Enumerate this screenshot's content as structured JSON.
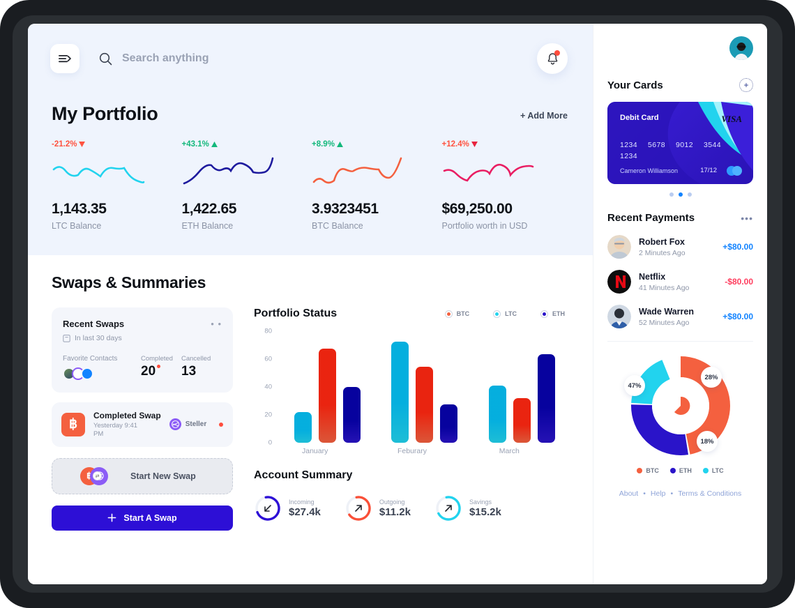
{
  "header": {
    "menu_icon": "hamburger-arrow-icon",
    "search_placeholder": "Search anything",
    "search_value": "",
    "search_icon": "search-icon",
    "bell_icon": "bell-icon"
  },
  "portfolio": {
    "title": "My Portfolio",
    "add_more": "+ Add More",
    "cards": [
      {
        "change": "-21.2%",
        "direction": "down",
        "value": "1,143.35",
        "label": "LTC Balance",
        "color": "#22d3ee"
      },
      {
        "change": "+43.1%",
        "direction": "up",
        "value": "1,422.65",
        "label": "ETH Balance",
        "color": "#1e1b9e"
      },
      {
        "change": "+8.9%",
        "direction": "up",
        "value": "3.9323451",
        "label": "BTC Balance",
        "color": "#f4603f"
      },
      {
        "change": "+12.4%",
        "direction": "down",
        "value": "$69,250.00",
        "label": "Portfolio worth in USD",
        "color": "#e91e63"
      }
    ]
  },
  "swaps": {
    "title": "Swaps & Summaries",
    "recent": {
      "title": "Recent Swaps",
      "subtitle": "In last 30 days",
      "calendar_icon": "calendar-icon",
      "menu_icon": "more-dots-icon",
      "favorite_label": "Favorite Contacts",
      "completed_label": "Completed",
      "completed_value": "20",
      "cancelled_label": "Cancelled",
      "cancelled_value": "13"
    },
    "completed_swap": {
      "coin_icon": "bitcoin-icon",
      "title": "Completed Swap",
      "time": "Yesterday 9:41 PM",
      "network": "Steller",
      "network_icon": "stellar-icon"
    },
    "new_swap": {
      "label": "Start New Swap"
    },
    "start_button": {
      "label": "Start A Swap",
      "plus_icon": "plus-icon"
    }
  },
  "chart_data": {
    "type": "bar",
    "title": "Portfolio Status",
    "categories": [
      "January",
      "Feburary",
      "March"
    ],
    "series": [
      {
        "name": "LTC",
        "color": "#22d3ee",
        "values": [
          24,
          80,
          45
        ]
      },
      {
        "name": "BTC",
        "color": "#f4603f",
        "values": [
          74,
          60,
          35
        ]
      },
      {
        "name": "ETH",
        "color": "#2a14c9",
        "values": [
          44,
          30,
          70
        ]
      }
    ],
    "legend": [
      "BTC",
      "LTC",
      "ETH"
    ],
    "legend_colors": {
      "BTC": "#f4603f",
      "LTC": "#22d3ee",
      "ETH": "#2a14c9"
    },
    "legend_position": "top-right",
    "yticks": [
      "80",
      "60",
      "40",
      "20",
      "0"
    ],
    "ylim": [
      0,
      88
    ],
    "xlabel": "",
    "ylabel": "",
    "grid": false
  },
  "account_summary": {
    "title": "Account Summary",
    "items": [
      {
        "label": "Incoming",
        "value": "$27.4k",
        "color": "#2d0fd6",
        "arrow": "arrow-down-left-icon",
        "pct": 72
      },
      {
        "label": "Outgoing",
        "value": "$11.2k",
        "color": "#fa5038",
        "arrow": "arrow-up-right-icon",
        "pct": 68
      },
      {
        "label": "Savings",
        "value": "$15.2k",
        "color": "#22d3ee",
        "arrow": "arrow-up-right-icon",
        "pct": 70
      }
    ]
  },
  "sidebar": {
    "cards_title": "Your Cards",
    "add_card_icon": "plus-circle-icon",
    "card": {
      "type": "Debit Card",
      "brand": "VISA",
      "number_groups": [
        "1234",
        "5678",
        "9012",
        "3544",
        "1234"
      ],
      "holder": "Cameron Williamson",
      "expiry": "17/12"
    },
    "carousel": {
      "count": 3,
      "active": 1
    },
    "payments_title": "Recent Payments",
    "payments_menu_icon": "more-dots-icon",
    "payments": [
      {
        "name": "Robert Fox",
        "time": "2 Minutes Ago",
        "amount": "+$80.00",
        "type": "positive"
      },
      {
        "name": "Netflix",
        "time": "41 Minutes Ago",
        "amount": "-$80.00",
        "type": "negative"
      },
      {
        "name": "Wade Warren",
        "time": "52 Minutes Ago",
        "amount": "+$80.00",
        "type": "positive"
      }
    ],
    "donut": {
      "type": "pie",
      "slices": [
        {
          "name": "BTC",
          "value": 47,
          "label": "47%",
          "color": "#f4603f"
        },
        {
          "name": "ETH",
          "value": 28,
          "label": "28%",
          "color": "#2a14c9"
        },
        {
          "name": "LTC",
          "value": 18,
          "label": "18%",
          "color": "#22d3ee"
        }
      ],
      "legend": [
        "BTC",
        "ETH",
        "LTC"
      ]
    },
    "footer_links": [
      "About",
      "Help",
      "Terms & Conditions"
    ],
    "footer_sep": "•"
  }
}
